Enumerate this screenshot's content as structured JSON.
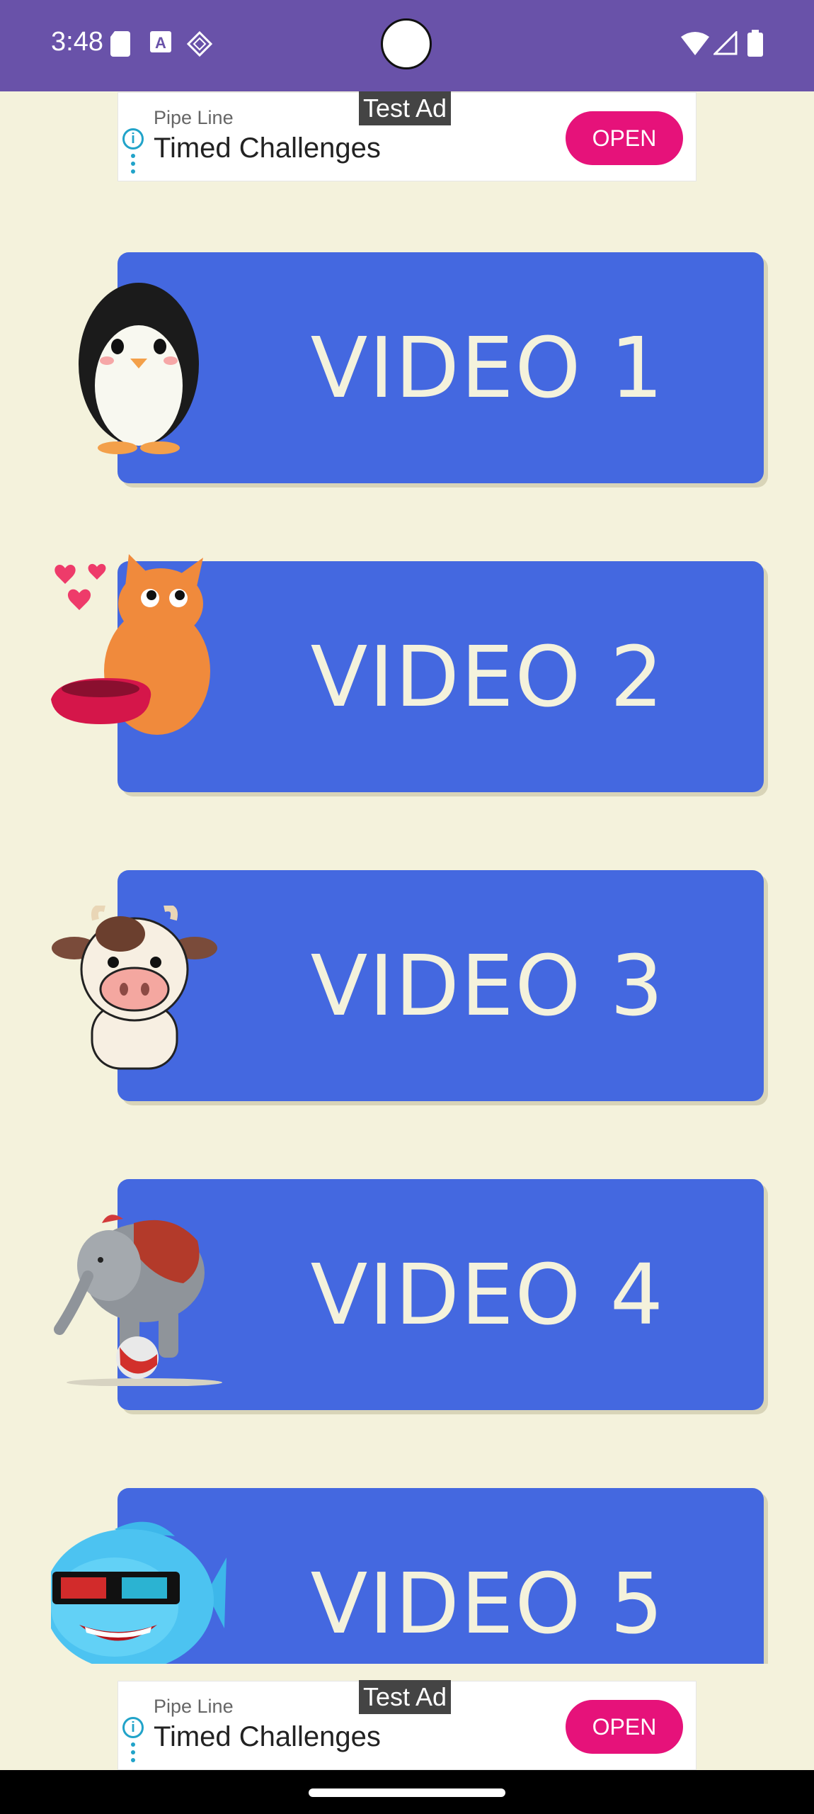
{
  "status_bar": {
    "time": "3:48",
    "icons_left": [
      "sd-card-icon",
      "font-icon",
      "diamond-icon"
    ],
    "icons_right": [
      "wifi-icon",
      "signal-icon",
      "battery-icon"
    ]
  },
  "ad_top": {
    "badge": "Test Ad",
    "advertiser": "Pipe Line",
    "title": "Timed Challenges",
    "cta": "OPEN"
  },
  "videos": [
    {
      "label": "VIDEO 1",
      "animal": "penguin-icon"
    },
    {
      "label": "VIDEO 2",
      "animal": "cat-icon"
    },
    {
      "label": "VIDEO 3",
      "animal": "cow-icon"
    },
    {
      "label": "VIDEO 4",
      "animal": "elephant-icon"
    },
    {
      "label": "VIDEO 5",
      "animal": "fish-icon"
    }
  ],
  "ad_bottom": {
    "badge": "Test Ad",
    "advertiser": "Pipe Line",
    "title": "Timed Challenges",
    "cta": "OPEN"
  },
  "colors": {
    "status_bar": "#6952a9",
    "background": "#f4f2dc",
    "button": "#4468e0",
    "button_text": "#f4f2dc",
    "ad_cta": "#e6127a"
  }
}
